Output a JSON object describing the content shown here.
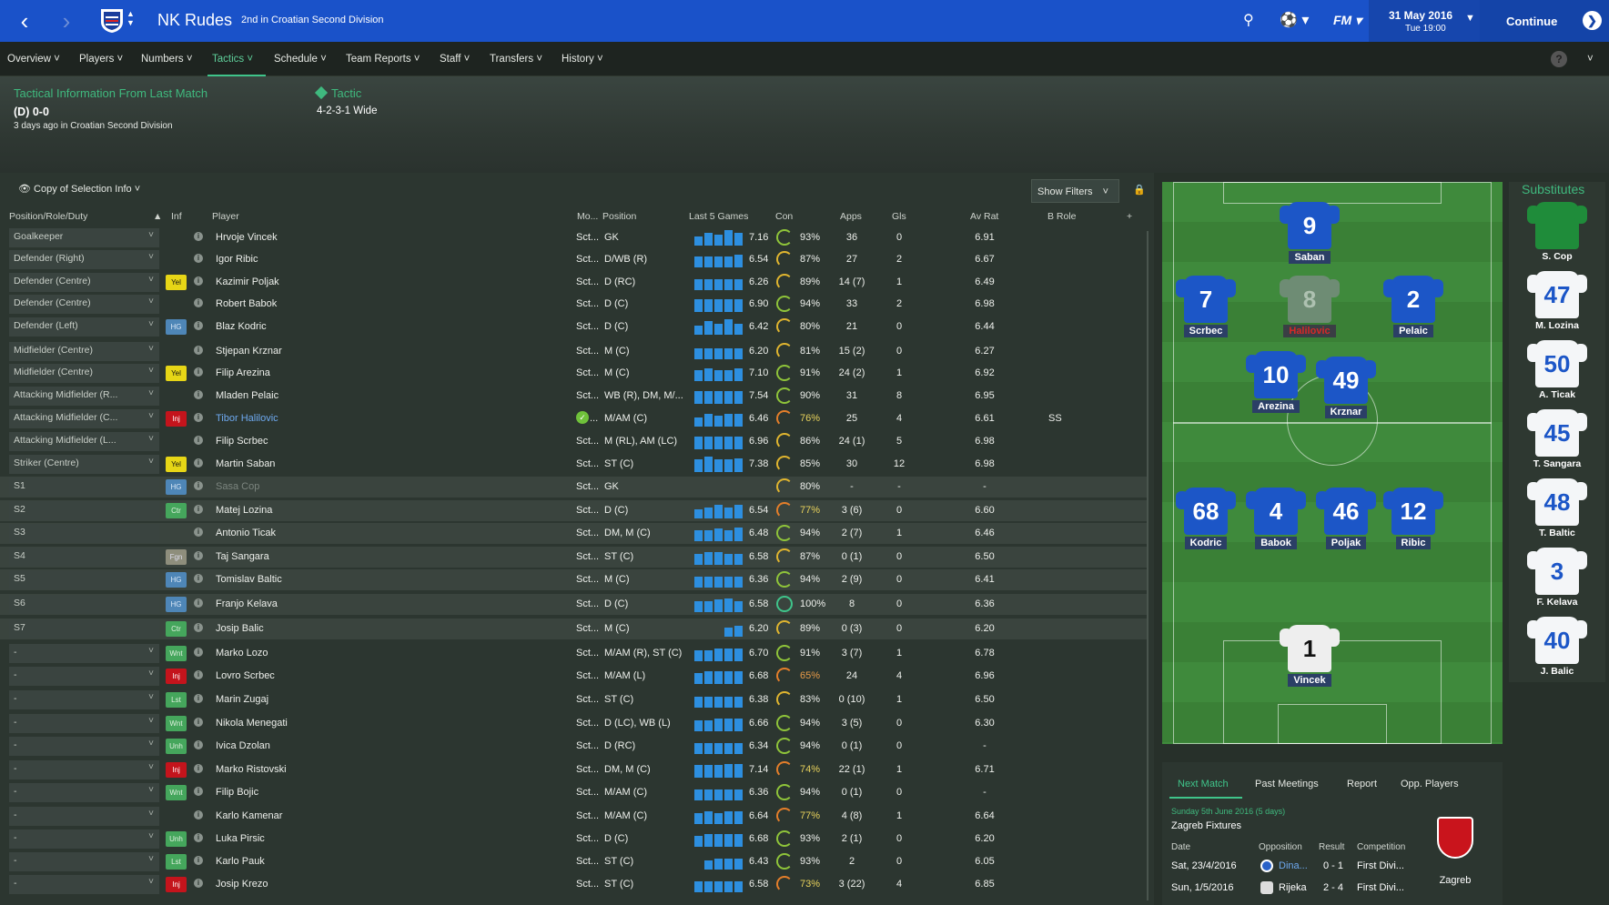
{
  "topbar": {
    "club_name": "NK Rudes",
    "club_sub": "2nd in Croatian Second Division",
    "date": "31 May 2016",
    "time": "Tue 19:00",
    "continue": "Continue"
  },
  "menu": [
    "Overview",
    "Players",
    "Numbers",
    "Tactics",
    "Schedule",
    "Team Reports",
    "Staff",
    "Transfers",
    "History"
  ],
  "hero": {
    "title": "Tactical Information From Last Match",
    "result": "(D) 0-0",
    "when": "3 days ago in Croatian Second Division",
    "tactic_label": "Tactic",
    "tactic_value": "4-2-3-1 Wide"
  },
  "selection": {
    "label": "Copy of Selection Info",
    "filters": "Show Filters"
  },
  "headers": {
    "pos": "Position/Role/Duty",
    "inf": "Inf",
    "player": "Player",
    "mo": "Mo...",
    "position": "Position",
    "last5": "Last 5 Games",
    "con": "Con",
    "apps": "Apps",
    "gls": "Gls",
    "avrat": "Av Rat",
    "brole": "B Role"
  },
  "rows": [
    {
      "pos": "Goalkeeper",
      "inf": "",
      "name": "Hrvoje Vincek",
      "mo": "Sct...",
      "position": "GK",
      "bars": [
        0.6,
        0.8,
        0.7,
        1,
        0.8
      ],
      "l5": "7.16",
      "con": "93%",
      "apps": "36",
      "gls": "0",
      "av": "6.91",
      "br": ""
    },
    {
      "pos": "Defender (Right)",
      "inf": "",
      "name": "Igor Ribic",
      "mo": "Sct...",
      "position": "D/WB (R)",
      "bars": [
        0.7,
        0.7,
        0.7,
        0.7,
        0.8
      ],
      "l5": "6.54",
      "con": "87%",
      "apps": "27",
      "gls": "2",
      "av": "6.67",
      "br": ""
    },
    {
      "pos": "Defender (Centre)",
      "inf": "Yel",
      "name": "Kazimir Poljak",
      "mo": "Sct...",
      "position": "D (RC)",
      "bars": [
        0.7,
        0.7,
        0.7,
        0.7,
        0.7
      ],
      "l5": "6.26",
      "con": "89%",
      "apps": "14 (7)",
      "gls": "1",
      "av": "6.49",
      "br": ""
    },
    {
      "pos": "Defender (Centre)",
      "inf": "",
      "name": "Robert Babok",
      "mo": "Sct...",
      "position": "D (C)",
      "bars": [
        0.8,
        0.8,
        0.8,
        0.8,
        0.8
      ],
      "l5": "6.90",
      "con": "94%",
      "apps": "33",
      "gls": "2",
      "av": "6.98",
      "br": ""
    },
    {
      "pos": "Defender (Left)",
      "inf": "HG",
      "name": "Blaz Kodric",
      "mo": "Sct...",
      "position": "D (C)",
      "bars": [
        0.6,
        0.9,
        0.7,
        1,
        0.7
      ],
      "l5": "6.42",
      "con": "80%",
      "apps": "21",
      "gls": "0",
      "av": "6.44",
      "br": ""
    },
    {
      "pos": "Midfielder (Centre)",
      "inf": "",
      "name": "Stjepan Krznar",
      "mo": "Sct...",
      "position": "M (C)",
      "bars": [
        0.7,
        0.7,
        0.7,
        0.7,
        0.7
      ],
      "l5": "6.20",
      "con": "81%",
      "apps": "15 (2)",
      "gls": "0",
      "av": "6.27",
      "br": ""
    },
    {
      "pos": "Midfielder (Centre)",
      "inf": "Yel",
      "name": "Filip Arezina",
      "mo": "Sct...",
      "position": "M (C)",
      "bars": [
        0.7,
        0.8,
        0.7,
        0.7,
        0.8
      ],
      "l5": "7.10",
      "con": "91%",
      "apps": "24 (2)",
      "gls": "1",
      "av": "6.92",
      "br": ""
    },
    {
      "pos": "Attacking Midfielder (R...",
      "inf": "",
      "name": "Mladen Pelaic",
      "mo": "Sct...",
      "position": "WB (R), DM, M/...",
      "bars": [
        0.8,
        0.8,
        0.8,
        0.8,
        0.8
      ],
      "l5": "7.54",
      "con": "90%",
      "apps": "31",
      "gls": "8",
      "av": "6.95",
      "br": ""
    },
    {
      "pos": "Attacking Midfielder (C...",
      "inf": "Inj",
      "name": "Tibor Halilovic",
      "mo": "...",
      "position": "M/AM (C)",
      "bars": [
        0.6,
        0.8,
        0.7,
        0.8,
        0.8
      ],
      "l5": "6.46",
      "con": "76%",
      "apps": "25",
      "gls": "4",
      "av": "6.61",
      "br": "SS"
    },
    {
      "pos": "Attacking Midfielder (L...",
      "inf": "",
      "name": "Filip Scrbec",
      "mo": "Sct...",
      "position": "M (RL), AM (LC)",
      "bars": [
        0.8,
        0.8,
        0.8,
        0.8,
        0.8
      ],
      "l5": "6.96",
      "con": "86%",
      "apps": "24 (1)",
      "gls": "5",
      "av": "6.98",
      "br": ""
    },
    {
      "pos": "Striker (Centre)",
      "inf": "Yel",
      "name": "Martin Saban",
      "mo": "Sct...",
      "position": "ST (C)",
      "bars": [
        0.8,
        1,
        0.8,
        0.8,
        0.9
      ],
      "l5": "7.38",
      "con": "85%",
      "apps": "30",
      "gls": "12",
      "av": "6.98",
      "br": ""
    },
    {
      "pos": "S1",
      "inf": "HG",
      "name": "Sasa Cop",
      "mo": "Sct...",
      "position": "GK",
      "bars": [],
      "l5": "",
      "con": "80%",
      "apps": "-",
      "gls": "-",
      "av": "-",
      "br": ""
    },
    {
      "pos": "S2",
      "inf": "Ctr",
      "name": "Matej Lozina",
      "mo": "Sct...",
      "position": "D (C)",
      "bars": [
        0.6,
        0.7,
        0.9,
        0.7,
        0.9
      ],
      "l5": "6.54",
      "con": "77%",
      "apps": "3 (6)",
      "gls": "0",
      "av": "6.60",
      "br": ""
    },
    {
      "pos": "S3",
      "inf": "",
      "name": "Antonio Ticak",
      "mo": "Sct...",
      "position": "DM, M (C)",
      "bars": [
        0.7,
        0.7,
        0.8,
        0.7,
        0.9
      ],
      "l5": "6.48",
      "con": "94%",
      "apps": "2 (7)",
      "gls": "1",
      "av": "6.46",
      "br": ""
    },
    {
      "pos": "S4",
      "inf": "Fgn",
      "name": "Taj Sangara",
      "mo": "Sct...",
      "position": "ST (C)",
      "bars": [
        0.7,
        0.8,
        0.8,
        0.7,
        0.7
      ],
      "l5": "6.58",
      "con": "87%",
      "apps": "0 (1)",
      "gls": "0",
      "av": "6.50",
      "br": ""
    },
    {
      "pos": "S5",
      "inf": "HG",
      "name": "Tomislav Baltic",
      "mo": "Sct...",
      "position": "M (C)",
      "bars": [
        0.7,
        0.7,
        0.7,
        0.7,
        0.7
      ],
      "l5": "6.36",
      "con": "94%",
      "apps": "2 (9)",
      "gls": "0",
      "av": "6.41",
      "br": ""
    },
    {
      "pos": "S6",
      "inf": "HG",
      "name": "Franjo Kelava",
      "mo": "Sct...",
      "position": "D (C)",
      "bars": [
        0.7,
        0.7,
        0.8,
        0.9,
        0.7
      ],
      "l5": "6.58",
      "con": "100%",
      "apps": "8",
      "gls": "0",
      "av": "6.36",
      "br": ""
    },
    {
      "pos": "S7",
      "inf": "Ctr",
      "name": "Josip Balic",
      "mo": "Sct...",
      "position": "M (C)",
      "bars": [
        0,
        0,
        0,
        0.6,
        0.7
      ],
      "l5": "6.20",
      "con": "89%",
      "apps": "0 (3)",
      "gls": "0",
      "av": "6.20",
      "br": ""
    },
    {
      "pos": "-",
      "inf": "Wnt",
      "name": "Marko Lozo",
      "mo": "Sct...",
      "position": "M/AM (R), ST (C)",
      "bars": [
        0.7,
        0.7,
        0.8,
        0.8,
        0.8
      ],
      "l5": "6.70",
      "con": "91%",
      "apps": "3 (7)",
      "gls": "1",
      "av": "6.78",
      "br": ""
    },
    {
      "pos": "-",
      "inf": "Inj",
      "name": "Lovro Scrbec",
      "mo": "Sct...",
      "position": "M/AM (L)",
      "bars": [
        0.7,
        0.8,
        0.8,
        0.8,
        0.8
      ],
      "l5": "6.68",
      "con": "65%",
      "apps": "24",
      "gls": "4",
      "av": "6.96",
      "br": ""
    },
    {
      "pos": "-",
      "inf": "Lst",
      "name": "Marin Zugaj",
      "mo": "Sct...",
      "position": "ST (C)",
      "bars": [
        0.7,
        0.7,
        0.7,
        0.7,
        0.7
      ],
      "l5": "6.38",
      "con": "83%",
      "apps": "0 (10)",
      "gls": "1",
      "av": "6.50",
      "br": ""
    },
    {
      "pos": "-",
      "inf": "Wnt",
      "name": "Nikola Menegati",
      "mo": "Sct...",
      "position": "D (LC), WB (L)",
      "bars": [
        0.7,
        0.7,
        0.8,
        0.8,
        0.8
      ],
      "l5": "6.66",
      "con": "94%",
      "apps": "3 (5)",
      "gls": "0",
      "av": "6.30",
      "br": ""
    },
    {
      "pos": "-",
      "inf": "Unh",
      "name": "Ivica Dzolan",
      "mo": "Sct...",
      "position": "D (RC)",
      "bars": [
        0.7,
        0.7,
        0.7,
        0.7,
        0.7
      ],
      "l5": "6.34",
      "con": "94%",
      "apps": "0 (1)",
      "gls": "0",
      "av": "-",
      "br": ""
    },
    {
      "pos": "-",
      "inf": "Inj",
      "name": "Marko Ristovski",
      "mo": "Sct...",
      "position": "DM, M (C)",
      "bars": [
        0.8,
        0.8,
        0.8,
        0.9,
        0.9
      ],
      "l5": "7.14",
      "con": "74%",
      "apps": "22 (1)",
      "gls": "1",
      "av": "6.71",
      "br": ""
    },
    {
      "pos": "-",
      "inf": "Wnt",
      "name": "Filip Bojic",
      "mo": "Sct...",
      "position": "M/AM (C)",
      "bars": [
        0.7,
        0.7,
        0.7,
        0.7,
        0.7
      ],
      "l5": "6.36",
      "con": "94%",
      "apps": "0 (1)",
      "gls": "0",
      "av": "-",
      "br": ""
    },
    {
      "pos": "-",
      "inf": "",
      "name": "Karlo Kamenar",
      "mo": "Sct...",
      "position": "M/AM (C)",
      "bars": [
        0.7,
        0.8,
        0.7,
        0.8,
        0.8
      ],
      "l5": "6.64",
      "con": "77%",
      "apps": "4 (8)",
      "gls": "1",
      "av": "6.64",
      "br": ""
    },
    {
      "pos": "-",
      "inf": "Unh",
      "name": "Luka Pirsic",
      "mo": "Sct...",
      "position": "D (C)",
      "bars": [
        0.7,
        0.8,
        0.8,
        0.8,
        0.8
      ],
      "l5": "6.68",
      "con": "93%",
      "apps": "2 (1)",
      "gls": "0",
      "av": "6.20",
      "br": ""
    },
    {
      "pos": "-",
      "inf": "Lst",
      "name": "Karlo Pauk",
      "mo": "Sct...",
      "position": "ST (C)",
      "bars": [
        0,
        0.6,
        0.7,
        0.7,
        0.7
      ],
      "l5": "6.43",
      "con": "93%",
      "apps": "2",
      "gls": "0",
      "av": "6.05",
      "br": ""
    },
    {
      "pos": "-",
      "inf": "Inj",
      "name": "Josip Krezo",
      "mo": "Sct...",
      "position": "ST (C)",
      "bars": [
        0.7,
        0.7,
        0.7,
        0.7,
        0.7
      ],
      "l5": "6.58",
      "con": "73%",
      "apps": "3 (22)",
      "gls": "4",
      "av": "6.85",
      "br": ""
    }
  ],
  "pitch": [
    {
      "num": "9",
      "name": "Saban"
    },
    {
      "num": "7",
      "name": "Scrbec"
    },
    {
      "num": "8",
      "name": "Halilovic"
    },
    {
      "num": "2",
      "name": "Pelaic"
    },
    {
      "num": "10",
      "name": "Arezina"
    },
    {
      "num": "49",
      "name": "Krznar"
    },
    {
      "num": "68",
      "name": "Kodric"
    },
    {
      "num": "4",
      "name": "Babok"
    },
    {
      "num": "46",
      "name": "Poljak"
    },
    {
      "num": "12",
      "name": "Ribic"
    },
    {
      "num": "1",
      "name": "Vincek"
    }
  ],
  "substitutes": {
    "title": "Substitutes",
    "players": [
      {
        "num": "",
        "name": "S. Cop"
      },
      {
        "num": "47",
        "name": "M. Lozina"
      },
      {
        "num": "50",
        "name": "A. Ticak"
      },
      {
        "num": "45",
        "name": "T. Sangara"
      },
      {
        "num": "48",
        "name": "T. Baltic"
      },
      {
        "num": "3",
        "name": "F. Kelava"
      },
      {
        "num": "40",
        "name": "J. Balic"
      }
    ]
  },
  "next_match": {
    "tabs": [
      "Next Match",
      "Past Meetings",
      "Report",
      "Opp. Players"
    ],
    "date": "Sunday 5th June 2016 (5 days)",
    "fixtures_title": "Zagreb Fixtures",
    "cols": [
      "Date",
      "Opposition",
      "Result",
      "Competition"
    ],
    "fixtures": [
      {
        "date": "Sat, 23/4/2016",
        "opp": "Dina...",
        "result": "0 - 1",
        "comp": "First Divi..."
      },
      {
        "date": "Sun, 1/5/2016",
        "opp": "Rijeka",
        "result": "2 - 4",
        "comp": "First Divi..."
      }
    ],
    "opponent": "Zagreb"
  }
}
